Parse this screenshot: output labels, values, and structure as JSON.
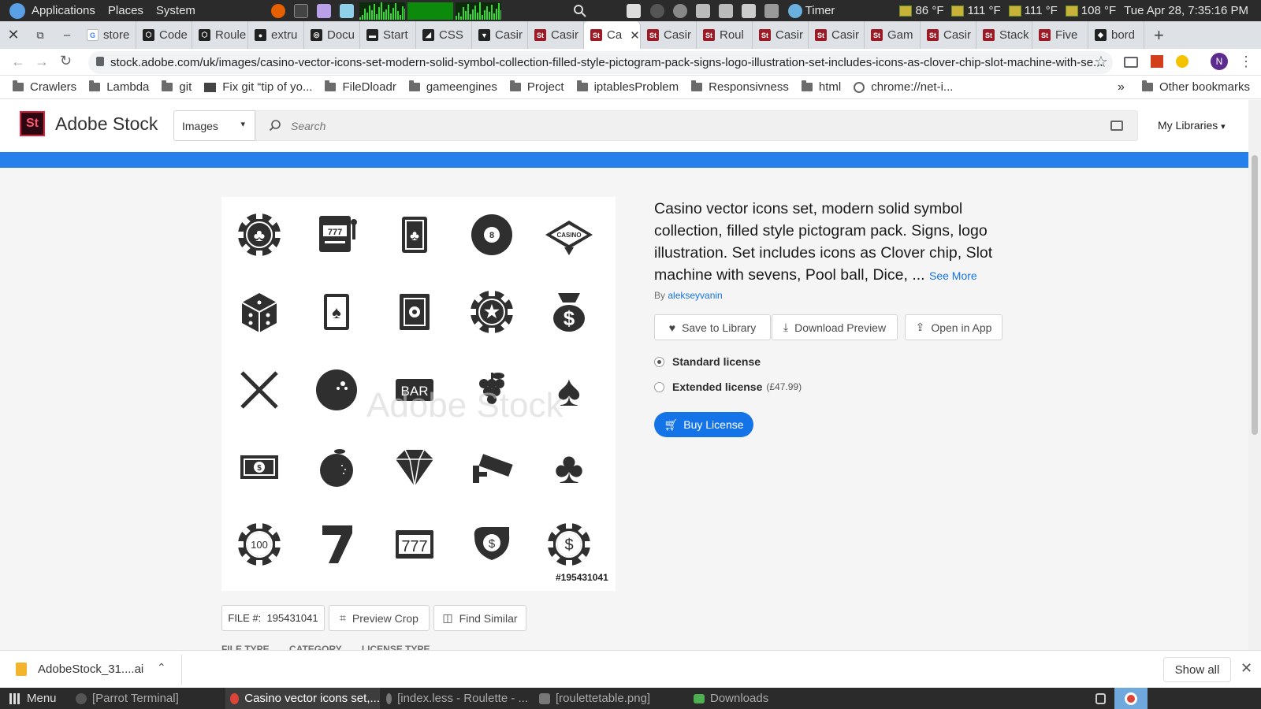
{
  "os": {
    "menus": [
      "Applications",
      "Places",
      "System"
    ],
    "timer_label": "Timer",
    "temps": [
      "86 °F",
      "111 °F",
      "111 °F",
      "108 °F"
    ],
    "clock": "Tue Apr 28, 7:35:16 PM"
  },
  "tabs": [
    {
      "label": "store",
      "fav": "G"
    },
    {
      "label": "Code",
      "fav": "⬡"
    },
    {
      "label": "Roule",
      "fav": "⬡"
    },
    {
      "label": "extru",
      "fav": "●"
    },
    {
      "label": "Docu",
      "fav": "◎"
    },
    {
      "label": "Start",
      "fav": "▬"
    },
    {
      "label": "CSS",
      "fav": "◢"
    },
    {
      "label": "Casir",
      "fav": "▼"
    },
    {
      "label": "Casir",
      "fav": "St"
    },
    {
      "label": "Ca",
      "fav": "St"
    },
    {
      "label": "Casir",
      "fav": "St"
    },
    {
      "label": "Roul",
      "fav": "St"
    },
    {
      "label": "Casir",
      "fav": "St"
    },
    {
      "label": "Casir",
      "fav": "St"
    },
    {
      "label": "Gam",
      "fav": "St"
    },
    {
      "label": "Casir",
      "fav": "St"
    },
    {
      "label": "Stack",
      "fav": "St"
    },
    {
      "label": "Five",
      "fav": "St"
    },
    {
      "label": "bord",
      "fav": "◆"
    }
  ],
  "toolbar": {
    "url": "stock.adobe.com/uk/images/casino-vector-icons-set-modern-solid-symbol-collection-filled-style-pictogram-pack-signs-logo-illustration-set-includes-icons-as-clover-chip-slot-machine-with-se...",
    "profile_initial": "N"
  },
  "bookmarks": {
    "items": [
      "Crawlers",
      "Lambda",
      "git",
      "Fix git “tip of yo...",
      "FileDloadr",
      "gameengines",
      "Project",
      "iptablesProblem",
      "Responsivness",
      "html",
      "chrome://net-i..."
    ],
    "overflow": "»",
    "other": "Other bookmarks"
  },
  "stock": {
    "logo_mark": "St",
    "logo_text": "Adobe Stock",
    "category": "Images",
    "search_placeholder": "Search",
    "my_libraries": "My Libraries",
    "watermark": "Adobe Stock",
    "file_number_label": "#195431041",
    "title": "Casino vector icons set, modern solid symbol collection, filled style pictogram pack. Signs, logo illustration. Set includes icons as Clover chip, Slot machine with sevens, Pool ball, Dice, ...",
    "see_more": "See More",
    "by": "By",
    "author": "alekseyvanin",
    "actions": {
      "save": "Save to Library",
      "download": "Download Preview",
      "open": "Open in App"
    },
    "licenses": {
      "standard": "Standard license",
      "extended": "Extended license",
      "extended_price": "(£47.99)"
    },
    "buy": "Buy License",
    "file_label": "FILE #:",
    "file_id": "195431041",
    "preview_crop": "Preview Crop",
    "find_similar": "Find Similar",
    "meta_headers": [
      "FILE TYPE",
      "CATEGORY",
      "LICENSE TYPE"
    ],
    "icons_grid": [
      "clover-chip-icon",
      "slot-machine-icon",
      "playing-card-clover-icon",
      "pool-ball-icon",
      "casino-sign-icon",
      "dice-icon",
      "playing-card-spade-icon",
      "safe-icon",
      "star-chip-icon",
      "money-bag-icon",
      "crossed-cues-icon",
      "pool-ball-3-icon",
      "bar-sign-icon",
      "grapes-icon",
      "spade-icon",
      "banknote-icon",
      "orange-icon",
      "diamond-icon",
      "security-camera-icon",
      "club-icon",
      "chip-100-icon",
      "seven-icon",
      "slot-777-icon",
      "cash-hand-icon",
      "dollar-chip-icon"
    ],
    "chip_label": "100",
    "bar_label": "BAR",
    "casino_label": "CASINO",
    "slot_label": "777"
  },
  "downloads": {
    "file": "AdobeStock_31....ai",
    "show_all": "Show all"
  },
  "taskbar": {
    "menu": "Menu",
    "items": [
      "[Parrot Terminal]",
      "Casino vector icons set,...",
      "[index.less - Roulette - ...",
      "[roulettetable.png]",
      "Downloads"
    ]
  }
}
